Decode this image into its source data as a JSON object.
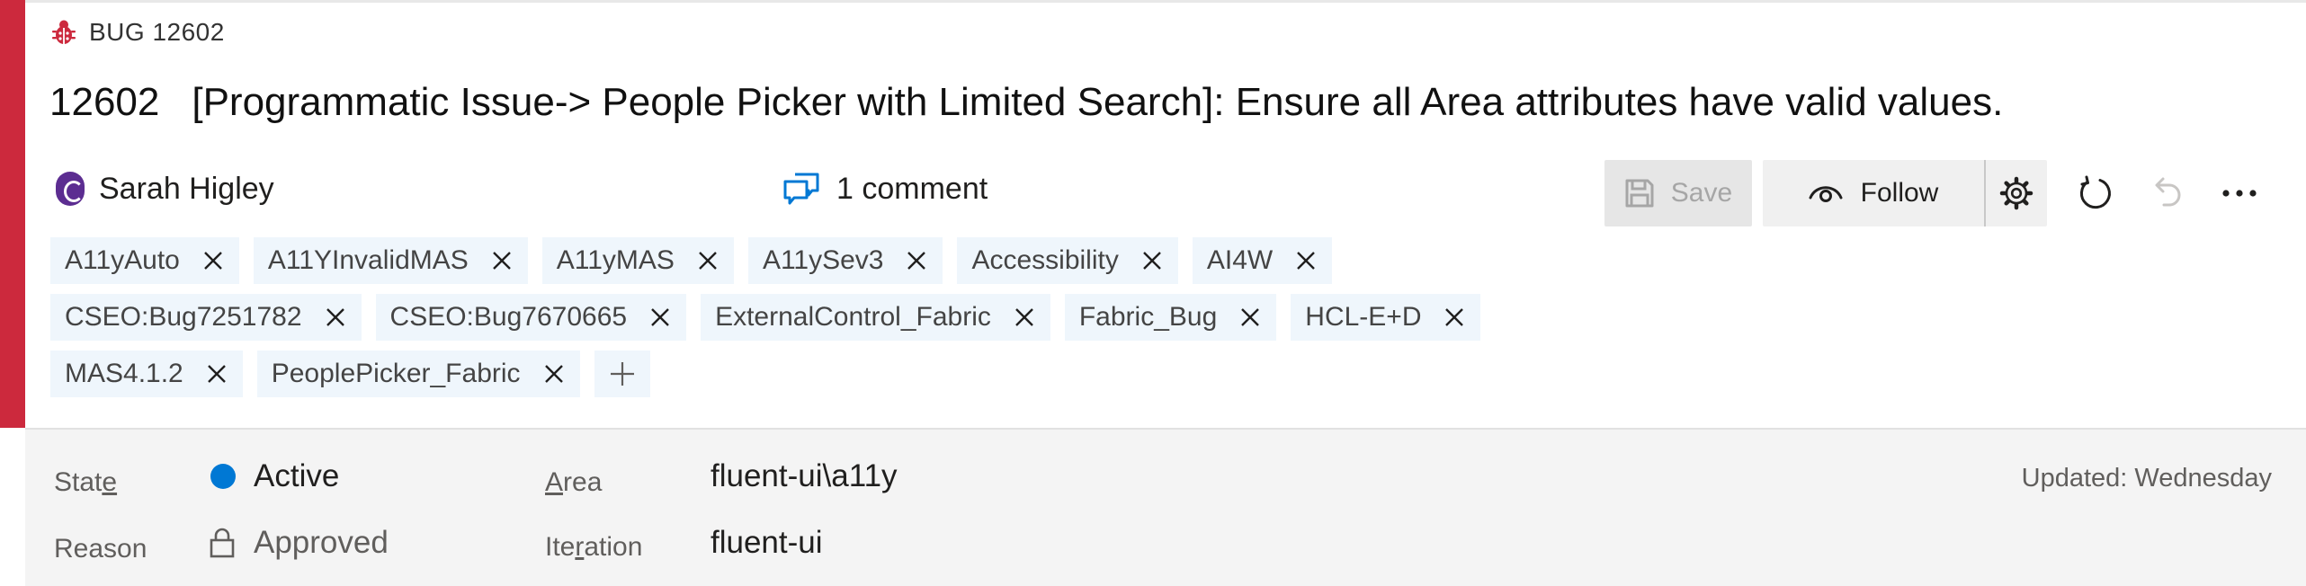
{
  "colors": {
    "bug_accent": "#cc293d",
    "state_active": "#0078d4",
    "tag_background": "#eff6fc",
    "avatar": "#5c2d91"
  },
  "header": {
    "type_icon": "bug-icon",
    "type_label": "BUG 12602",
    "id": "12602",
    "title": "[Programmatic Issue-> People Picker with Limited Search]: Ensure all Area attributes have valid values."
  },
  "meta": {
    "assignee": "Sarah Higley",
    "avatar_icon": "avatar",
    "comment_icon": "comments-icon",
    "comments_label": "1 comment"
  },
  "toolbar": {
    "save_label": "Save",
    "save_icon": "save-icon",
    "follow_label": "Follow",
    "follow_icon": "eye-icon",
    "settings_icon": "gear-icon",
    "refresh_icon": "refresh-icon",
    "undo_icon": "undo-icon",
    "more_icon": "more-icon"
  },
  "tags": [
    [
      "A11yAuto",
      "A11YInvalidMAS",
      "A11yMAS",
      "A11ySev3",
      "Accessibility",
      "AI4W"
    ],
    [
      "CSEO:Bug7251782",
      "CSEO:Bug7670665",
      "ExternalControl_Fabric",
      "Fabric_Bug",
      "HCL-E+D"
    ],
    [
      "MAS4.1.2",
      "PeoplePicker_Fabric"
    ]
  ],
  "fields": {
    "state": {
      "label_pre": "Stat",
      "label_key": "e",
      "label_post": "",
      "value": "Active"
    },
    "reason": {
      "label": "Reason",
      "value": "Approved",
      "icon": "lock-icon"
    },
    "area": {
      "label_pre": "",
      "label_key": "A",
      "label_post": "rea",
      "value": "fluent-ui\\a11y"
    },
    "iteration": {
      "label_pre": "Ite",
      "label_key": "r",
      "label_post": "ation",
      "value": "fluent-ui"
    },
    "updated": "Updated: Wednesday"
  }
}
